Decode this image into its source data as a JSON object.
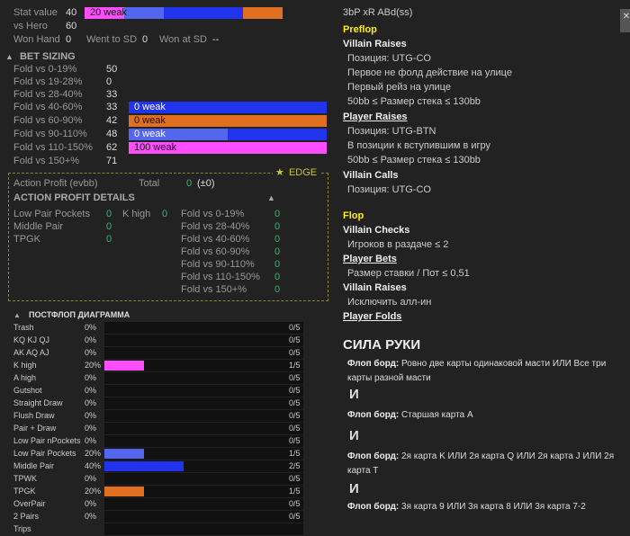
{
  "stats": {
    "stat_value_label": "Stat value",
    "stat_value": "40",
    "stat_bar_label": "20 weak",
    "vs_hero_label": "vs Hero",
    "vs_hero": "60",
    "won_hand_label": "Won Hand",
    "won_hand": "0",
    "went_sd_label": "Went to SD",
    "went_sd": "0",
    "won_sd_label": "Won at SD",
    "won_sd": "--"
  },
  "bet_sizing": {
    "title": "BET SIZING",
    "rows": [
      {
        "label": "Fold vs 0-19%",
        "value": "50",
        "bar": ""
      },
      {
        "label": "Fold vs 19-28%",
        "value": "0",
        "bar": ""
      },
      {
        "label": "Fold vs 28-40%",
        "value": "33",
        "bar": ""
      },
      {
        "label": "Fold vs 40-60%",
        "value": "33",
        "bar": "0 weak"
      },
      {
        "label": "Fold vs 60-90%",
        "value": "42",
        "bar": "0 weak"
      },
      {
        "label": "Fold vs 90-110%",
        "value": "48",
        "bar": "0 weak"
      },
      {
        "label": "Fold vs 110-150%",
        "value": "62",
        "bar": "100 weak"
      },
      {
        "label": "Fold vs 150+%",
        "value": "71",
        "bar": ""
      }
    ]
  },
  "edge": {
    "badge": "EDGE",
    "action_profit_label": "Action Profit (evbb)",
    "total_label": "Total",
    "total_value": "0",
    "total_delta": "(±0)",
    "details_title": "ACTION PROFIT DETAILS",
    "left_items": [
      {
        "label": "Low Pair Pockets",
        "value": "0"
      },
      {
        "label": "Middle Pair",
        "value": "0"
      },
      {
        "label": "TPGK",
        "value": "0"
      }
    ],
    "mid_item": {
      "label": "K high",
      "value": "0"
    },
    "right_items": [
      {
        "label": "Fold vs 0-19%",
        "value": "0"
      },
      {
        "label": "Fold vs 28-40%",
        "value": "0"
      },
      {
        "label": "Fold vs 40-60%",
        "value": "0"
      },
      {
        "label": "Fold vs 60-90%",
        "value": "0"
      },
      {
        "label": "Fold vs 90-110%",
        "value": "0"
      },
      {
        "label": "Fold vs 110-150%",
        "value": "0"
      },
      {
        "label": "Fold vs 150+%",
        "value": "0"
      }
    ]
  },
  "postflop": {
    "title": "ПОСТФЛОП ДИАГРАММА",
    "rows": [
      {
        "label": "Trash",
        "pct": "0%",
        "count": "0/5",
        "fraction": 0,
        "color": ""
      },
      {
        "label": "KQ KJ QJ",
        "pct": "0%",
        "count": "0/5",
        "fraction": 0,
        "color": ""
      },
      {
        "label": "AK AQ AJ",
        "pct": "0%",
        "count": "0/5",
        "fraction": 0,
        "color": ""
      },
      {
        "label": "K high",
        "pct": "20%",
        "count": "1/5",
        "fraction": 0.2,
        "color": "#ff4dff"
      },
      {
        "label": "A high",
        "pct": "0%",
        "count": "0/5",
        "fraction": 0,
        "color": ""
      },
      {
        "label": "Gutshot",
        "pct": "0%",
        "count": "0/5",
        "fraction": 0,
        "color": ""
      },
      {
        "label": "Straight Draw",
        "pct": "0%",
        "count": "0/5",
        "fraction": 0,
        "color": ""
      },
      {
        "label": "Flush Draw",
        "pct": "0%",
        "count": "0/5",
        "fraction": 0,
        "color": ""
      },
      {
        "label": "Pair + Draw",
        "pct": "0%",
        "count": "0/5",
        "fraction": 0,
        "color": ""
      },
      {
        "label": "Low Pair nPockets",
        "pct": "0%",
        "count": "0/5",
        "fraction": 0,
        "color": ""
      },
      {
        "label": "Low Pair Pockets",
        "pct": "20%",
        "count": "1/5",
        "fraction": 0.2,
        "color": "#5566ee"
      },
      {
        "label": "Middle Pair",
        "pct": "40%",
        "count": "2/5",
        "fraction": 0.4,
        "color": "#2233ee"
      },
      {
        "label": "TPWK",
        "pct": "0%",
        "count": "0/5",
        "fraction": 0,
        "color": ""
      },
      {
        "label": "TPGK",
        "pct": "20%",
        "count": "1/5",
        "fraction": 0.2,
        "color": "#e0701f"
      },
      {
        "label": "OverPair",
        "pct": "0%",
        "count": "0/5",
        "fraction": 0,
        "color": ""
      },
      {
        "label": "2 Pairs",
        "pct": "0%",
        "count": "0/5",
        "fraction": 0,
        "color": ""
      },
      {
        "label": "Trips",
        "pct": "",
        "count": "",
        "fraction": 0,
        "color": ""
      }
    ]
  },
  "filter": {
    "title": "3bP xR ABd(ss)",
    "preflop_label": "Preflop",
    "villain_raises_label": "Villain Raises",
    "vr_items": [
      "Позиция: UTG-CO",
      "Первое не фолд действие на улице",
      "Первый рейз на улице",
      "50bb ≤ Размер стека ≤ 130bb"
    ],
    "player_raises_label": "Player Raises",
    "pr_items": [
      "Позиция: UTG-BTN",
      "В позиции к вступившим в игру",
      "50bb ≤ Размер стека ≤ 130bb"
    ],
    "villain_calls_label": "Villain Calls",
    "vc_items": [
      "Позиция: UTG-CO"
    ],
    "flop_label": "Flop",
    "villain_checks_label": "Villain Checks",
    "vch_items": [
      "Игроков в раздаче ≤ 2"
    ],
    "player_bets_label": "Player Bets",
    "pb_items": [
      "Размер ставки / Пот ≤ 0,51"
    ],
    "villain_raises2_label": "Villain Raises",
    "vr2_items": [
      "Исключить алл-ин"
    ],
    "player_folds_label": "Player Folds",
    "hand_strength_title": "СИЛА РУКИ",
    "hs1": "Флоп борд: Ровно две карты одинаковой масти ИЛИ Все три карты разной масти",
    "and1": "И",
    "hs2": "Флоп борд: Старшая карта A",
    "and2": "И",
    "hs3": "Флоп борд: 2я карта K ИЛИ 2я карта Q ИЛИ 2я карта J ИЛИ 2я карта T",
    "and3": "И",
    "hs4": "Флоп борд: 3я карта 9 ИЛИ 3я карта 8 ИЛИ 3я карта 7-2"
  },
  "colors": {
    "weak_pink": "#ff4dff",
    "blue": "#2233ee",
    "orange": "#e0701f",
    "edge_border": "#888a2a",
    "yellow_heading": "#ffef00"
  }
}
